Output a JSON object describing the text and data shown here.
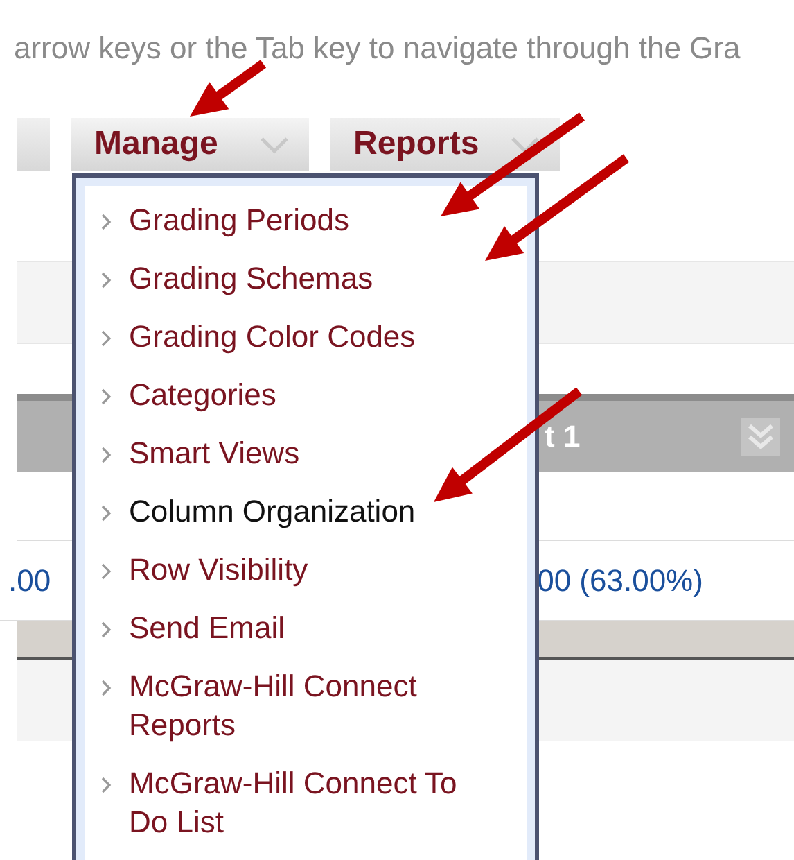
{
  "instructions": "arrow keys or the Tab key to navigate through the Gra",
  "tabs": [
    {
      "label": "Manage",
      "open": true
    },
    {
      "label": "Reports",
      "open": false
    }
  ],
  "table": {
    "header": "t 1",
    "cells": [
      ".00",
      "00 (63.00%)"
    ]
  },
  "menu": [
    {
      "label": "Grading Periods",
      "highlighted": false
    },
    {
      "label": "Grading Schemas",
      "highlighted": false
    },
    {
      "label": "Grading Color Codes",
      "highlighted": false
    },
    {
      "label": "Categories",
      "highlighted": false
    },
    {
      "label": "Smart Views",
      "highlighted": false
    },
    {
      "label": "Column Organization",
      "highlighted": true
    },
    {
      "label": "Row Visibility",
      "highlighted": false
    },
    {
      "label": "Send Email",
      "highlighted": false
    },
    {
      "label": "McGraw-Hill Connect Reports",
      "highlighted": false
    },
    {
      "label": "McGraw-Hill Connect To Do List",
      "highlighted": false
    }
  ]
}
